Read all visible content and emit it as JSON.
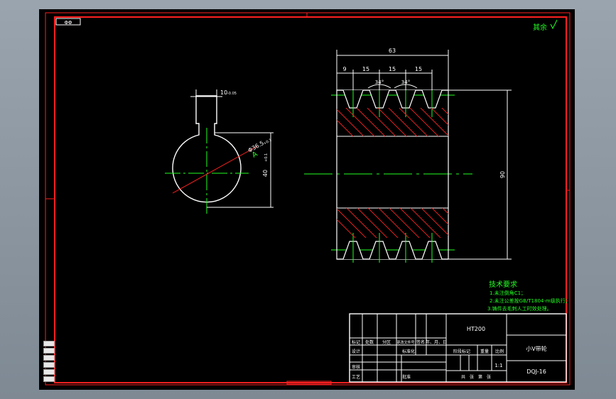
{
  "corner_box": "ΦΦ",
  "roughness_note": "其余",
  "dimensions": {
    "width_total": "63",
    "pitch_a": "9",
    "pitch_b": "15",
    "pitch_c": "15",
    "pitch_d": "15",
    "angle_a": "34°",
    "angle_b": "34°",
    "height": "90",
    "keyway_width": "10",
    "keyway_width_tol": "-0.05",
    "bore_depth": "40",
    "bore_depth_tol": "+0.1",
    "bore_dia": "Φ36.5",
    "bore_dia_tol": "+0.1",
    "datum": "A"
  },
  "tech_requirements": {
    "title": "技术要求",
    "lines": [
      "1.未注倒角C1；",
      "2.未注公差按GB/T1804-m级执行；",
      "3.铸件去毛刺人工时效处理。"
    ]
  },
  "title_block": {
    "material": "HT200",
    "part_name": "小V带轮",
    "drawing_no": "DQJ-16",
    "scale": "1:1",
    "headers_row1": [
      "标记",
      "处数",
      "分区",
      "更改文件号",
      "签名",
      "年、月、日"
    ],
    "labels": {
      "design": "设计",
      "standardize": "标准化",
      "review": "审核",
      "process": "工艺",
      "approve": "批准",
      "stage_mark": "阶段标记",
      "weight": "重量",
      "ratio": "比例",
      "sheets": "共　张　第　张"
    }
  },
  "colors": {
    "border": "#ff2020",
    "outline": "#ffffff",
    "center": "#22ff22",
    "hatch": "#e02020",
    "dim": "#ffffff",
    "magenta": "#ff20ff"
  }
}
